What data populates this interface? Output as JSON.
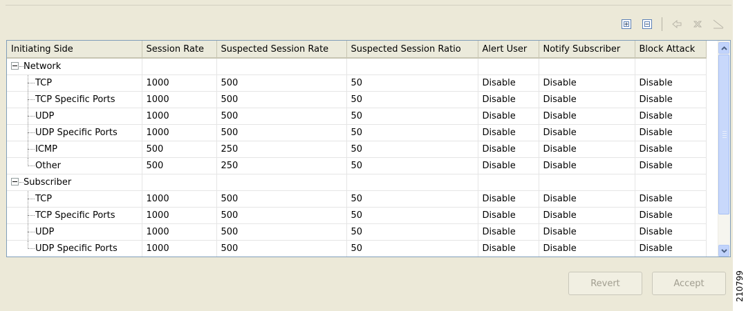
{
  "toolbar": {
    "expand_all_icon": "plus-box-icon",
    "collapse_all_icon": "minus-box-icon",
    "undo_icon": "arrow-icon",
    "delete_icon": "x-icon",
    "line_icon": "line-icon"
  },
  "table": {
    "columns": [
      "Initiating Side",
      "Session Rate",
      "Suspected Session Rate",
      "Suspected Session Ratio",
      "Alert User",
      "Notify Subscriber",
      "Block Attack"
    ],
    "groups": [
      {
        "label": "Network",
        "rows": [
          {
            "name": "TCP",
            "session_rate": "1000",
            "suspected_rate": "500",
            "suspected_ratio": "50",
            "alert": "Disable",
            "notify": "Disable",
            "block": "Disable"
          },
          {
            "name": "TCP Specific Ports",
            "session_rate": "1000",
            "suspected_rate": "500",
            "suspected_ratio": "50",
            "alert": "Disable",
            "notify": "Disable",
            "block": "Disable"
          },
          {
            "name": "UDP",
            "session_rate": "1000",
            "suspected_rate": "500",
            "suspected_ratio": "50",
            "alert": "Disable",
            "notify": "Disable",
            "block": "Disable"
          },
          {
            "name": "UDP Specific Ports",
            "session_rate": "1000",
            "suspected_rate": "500",
            "suspected_ratio": "50",
            "alert": "Disable",
            "notify": "Disable",
            "block": "Disable"
          },
          {
            "name": "ICMP",
            "session_rate": "500",
            "suspected_rate": "250",
            "suspected_ratio": "50",
            "alert": "Disable",
            "notify": "Disable",
            "block": "Disable"
          },
          {
            "name": "Other",
            "session_rate": "500",
            "suspected_rate": "250",
            "suspected_ratio": "50",
            "alert": "Disable",
            "notify": "Disable",
            "block": "Disable"
          }
        ]
      },
      {
        "label": "Subscriber",
        "rows": [
          {
            "name": "TCP",
            "session_rate": "1000",
            "suspected_rate": "500",
            "suspected_ratio": "50",
            "alert": "Disable",
            "notify": "Disable",
            "block": "Disable"
          },
          {
            "name": "TCP Specific Ports",
            "session_rate": "1000",
            "suspected_rate": "500",
            "suspected_ratio": "50",
            "alert": "Disable",
            "notify": "Disable",
            "block": "Disable"
          },
          {
            "name": "UDP",
            "session_rate": "1000",
            "suspected_rate": "500",
            "suspected_ratio": "50",
            "alert": "Disable",
            "notify": "Disable",
            "block": "Disable"
          },
          {
            "name": "UDP Specific Ports",
            "session_rate": "1000",
            "suspected_rate": "500",
            "suspected_ratio": "50",
            "alert": "Disable",
            "notify": "Disable",
            "block": "Disable"
          }
        ]
      }
    ]
  },
  "buttons": {
    "revert": "Revert",
    "accept": "Accept"
  },
  "figure_id": "210799"
}
